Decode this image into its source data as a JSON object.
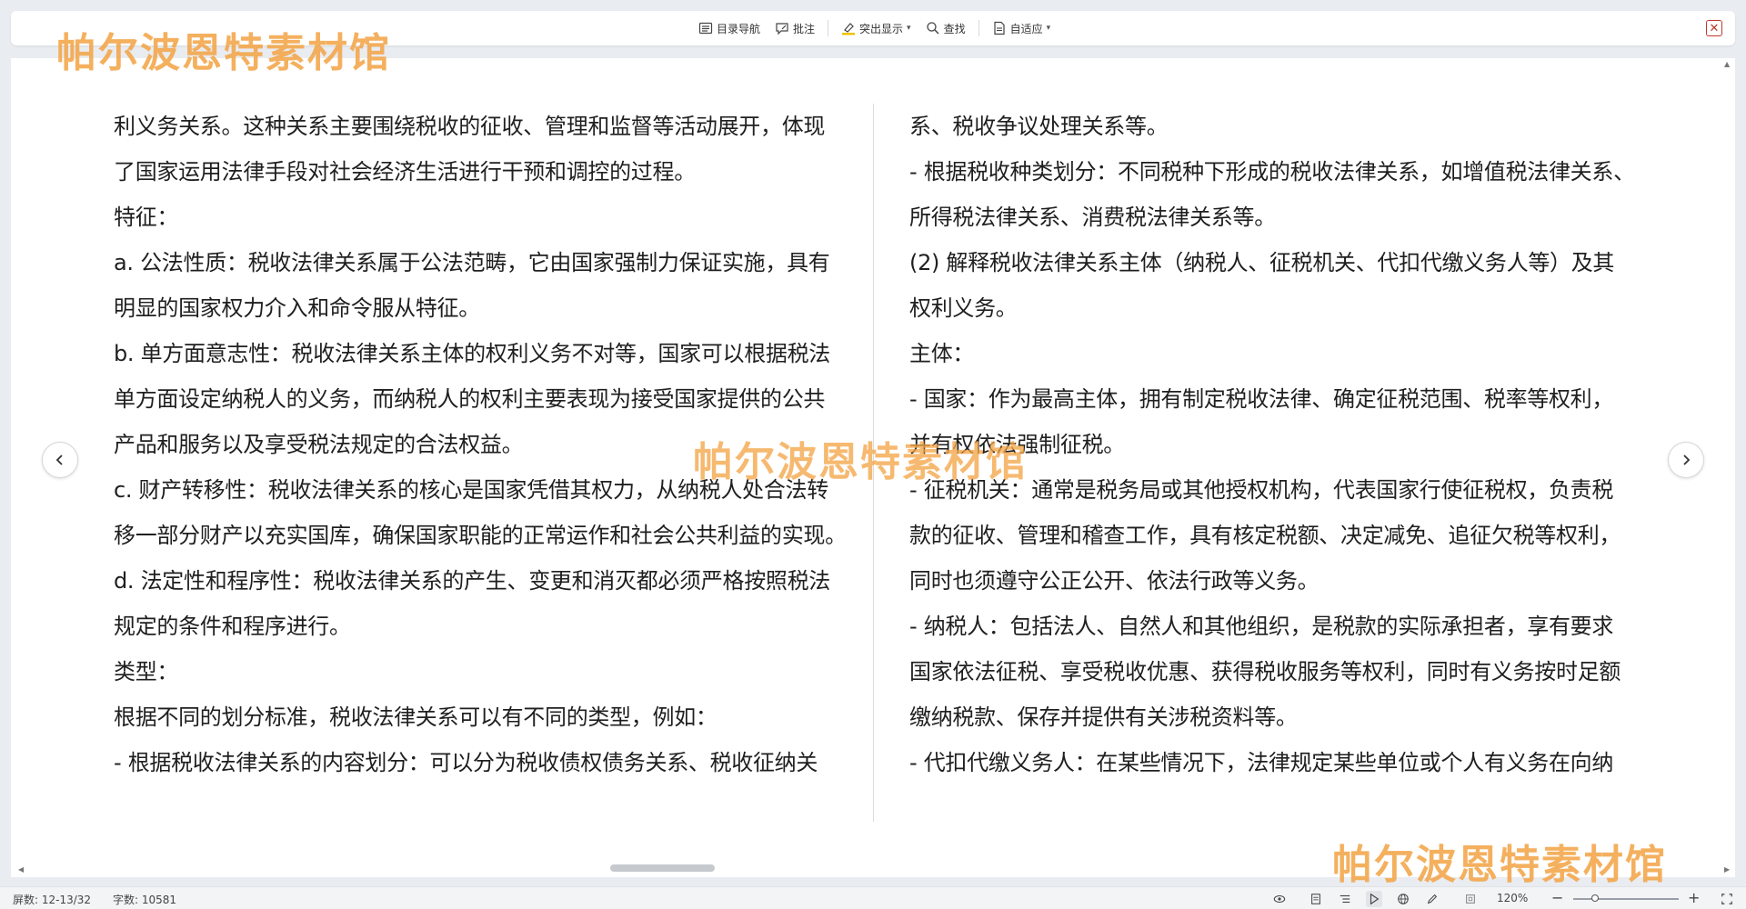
{
  "toolbar": {
    "toc_nav": "目录导航",
    "annotate": "批注",
    "highlight": "突出显示",
    "find": "查找",
    "fit": "自适应",
    "close_symbol": "✕"
  },
  "document": {
    "left_column": [
      "利义务关系。这种关系主要围绕税收的征收、管理和监督等活动展开，体现",
      "了国家运用法律手段对社会经济生活进行干预和调控的过程。",
      "特征：",
      "a. 公法性质：税收法律关系属于公法范畴，它由国家强制力保证实施，具有",
      "明显的国家权力介入和命令服从特征。",
      "b. 单方面意志性：税收法律关系主体的权利义务不对等，国家可以根据税法",
      "单方面设定纳税人的义务，而纳税人的权利主要表现为接受国家提供的公共",
      "产品和服务以及享受税法规定的合法权益。",
      "c. 财产转移性：税收法律关系的核心是国家凭借其权力，从纳税人处合法转",
      "移一部分财产以充实国库，确保国家职能的正常运作和社会公共利益的实现。",
      "d. 法定性和程序性：税收法律关系的产生、变更和消灭都必须严格按照税法",
      "规定的条件和程序进行。",
      "类型：",
      "根据不同的划分标准，税收法律关系可以有不同的类型，例如：",
      "- 根据税收法律关系的内容划分：可以分为税收债权债务关系、税收征纳关"
    ],
    "right_column": [
      "系、税收争议处理关系等。",
      "- 根据税收种类划分：不同税种下形成的税收法律关系，如增值税法律关系、",
      "所得税法律关系、消费税法律关系等。",
      "(2) 解释税收法律关系主体（纳税人、征税机关、代扣代缴义务人等）及其",
      "权利义务。",
      "主体：",
      "- 国家：作为最高主体，拥有制定税收法律、确定征税范围、税率等权利，",
      "并有权依法强制征税。",
      "- 征税机关：通常是税务局或其他授权机构，代表国家行使征税权，负责税",
      "款的征收、管理和稽查工作，具有核定税额、决定减免、追征欠税等权利，",
      "同时也须遵守公正公开、依法行政等义务。",
      "- 纳税人：包括法人、自然人和其他组织，是税款的实际承担者，享有要求",
      "国家依法征税、享受税收优惠、获得税收服务等权利，同时有义务按时足额",
      "缴纳税款、保存并提供有关涉税资料等。",
      "- 代扣代缴义务人：在某些情况下，法律规定某些单位或个人有义务在向纳"
    ]
  },
  "watermark": {
    "text_top": "帕尔波恩特素材馆",
    "text_center": "帕尔波恩特素材馆",
    "text_bottom": "帕尔波恩特素材馆",
    "color": "#f3a548"
  },
  "navigation": {
    "prev_symbol": "‹",
    "next_symbol": "›"
  },
  "statusbar": {
    "screen": "屏数: 12-13/32",
    "word_count": "字数: 10581",
    "zoom": "120%",
    "zoom_minus": "−",
    "zoom_plus": "+",
    "icons": [
      "eye-icon",
      "page-view-icon",
      "outline-view-icon",
      "play-icon",
      "web-icon",
      "pen-icon",
      "fullscreen-icon"
    ]
  }
}
